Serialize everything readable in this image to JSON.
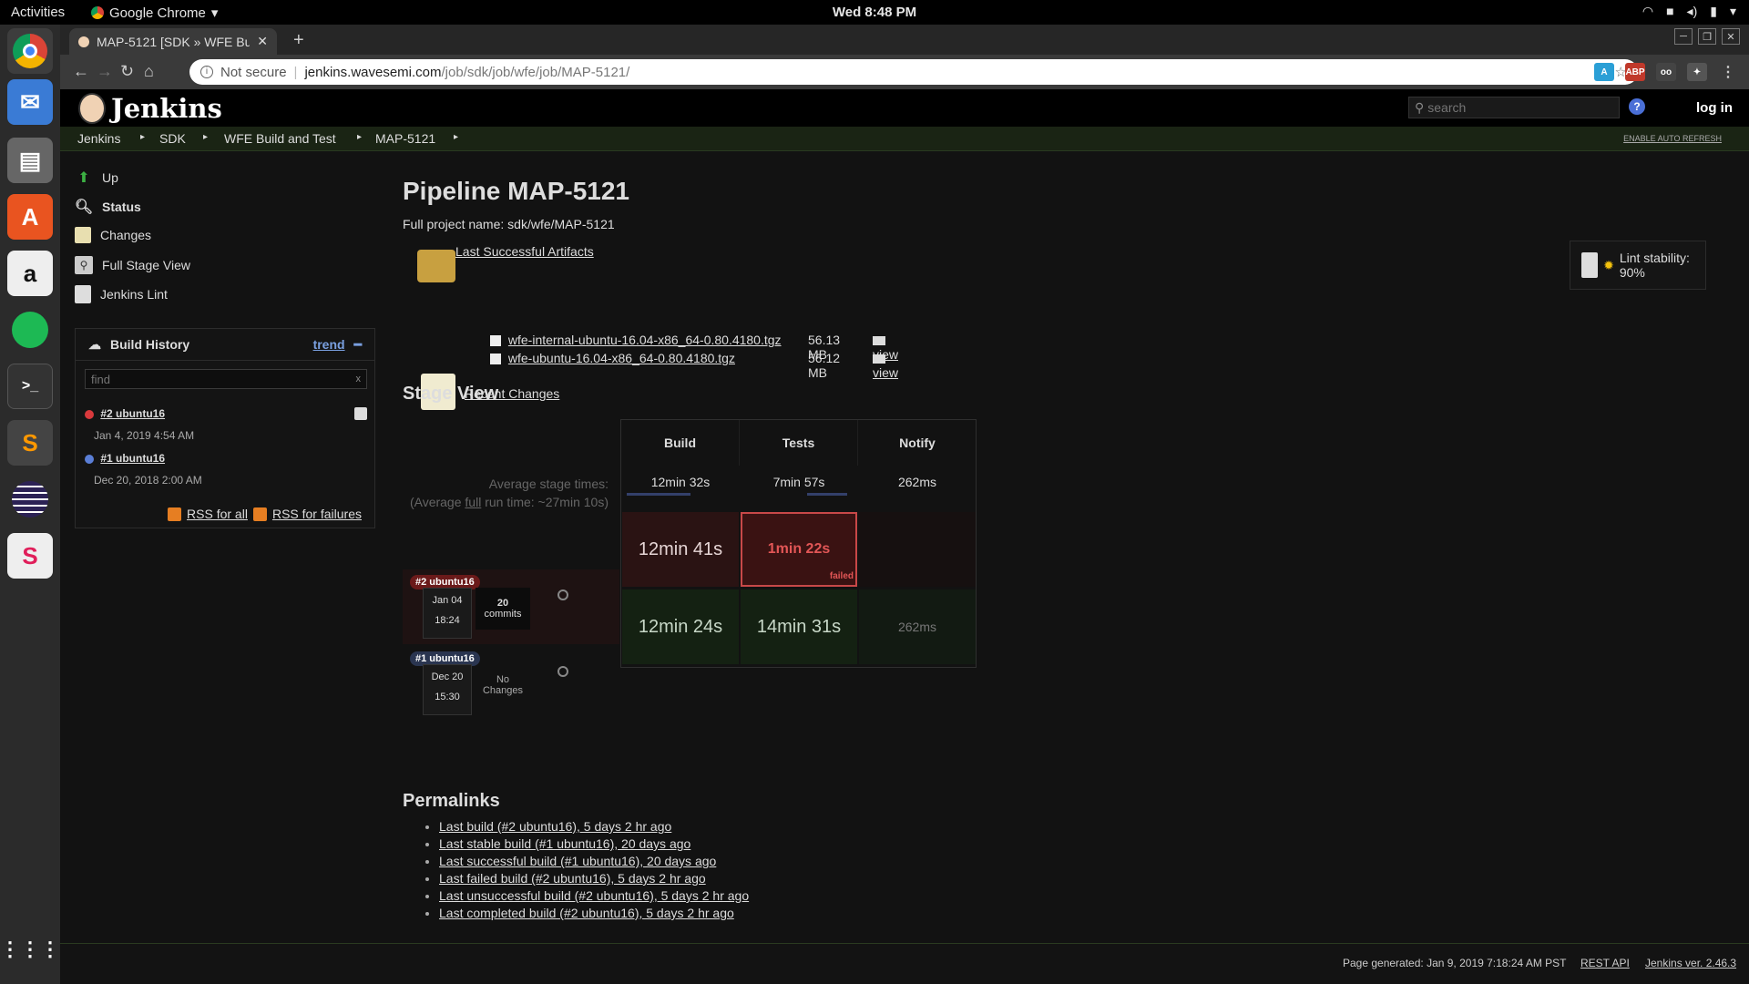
{
  "topbar": {
    "activities": "Activities",
    "app_name": "Google Chrome",
    "clock": "Wed  8:48 PM"
  },
  "browser": {
    "tab_title": "MAP-5121 [SDK » WFE Bu",
    "not_secure": "Not secure",
    "url_host": "jenkins.wavesemi.com",
    "url_path": "/job/sdk/job/wfe/job/MAP-5121/"
  },
  "jenkins": {
    "logo": "Jenkins",
    "search_placeholder": "search",
    "help": "?",
    "login": "log in"
  },
  "breadcrumbs": [
    "Jenkins",
    "SDK",
    "WFE Build and Test",
    "MAP-5121"
  ],
  "auto_refresh": "ENABLE AUTO REFRESH",
  "sidebar": {
    "tasks": [
      "Up",
      "Status",
      "Changes",
      "Full Stage View",
      "Jenkins Lint"
    ]
  },
  "build_history": {
    "title": "Build History",
    "trend": "trend",
    "find_placeholder": "find",
    "clear": "x",
    "builds": [
      {
        "label": "#2 ubuntu16",
        "date": "Jan 4, 2019 4:54 AM",
        "status_color": "#d9393c"
      },
      {
        "label": "#1 ubuntu16",
        "date": "Dec 20, 2018 2:00 AM",
        "status_color": "#5a7ed6"
      }
    ],
    "rss_all": "RSS for all",
    "rss_failures": "RSS for failures"
  },
  "main": {
    "title": "Pipeline MAP-5121",
    "full_name": "Full project name: sdk/wfe/MAP-5121",
    "last_artifacts": "Last Successful Artifacts",
    "artifacts": [
      {
        "file": "wfe-internal-ubuntu-16.04-x86_64-0.80.4180.tgz",
        "size": "56.13 MB",
        "view": "view"
      },
      {
        "file": "wfe-ubuntu-16.04-x86_64-0.80.4180.tgz",
        "size": "56.12 MB",
        "view": "view"
      }
    ],
    "recent_changes": "Recent Changes",
    "lint_stability": "Lint stability: 90%"
  },
  "stage_view": {
    "title": "Stage View",
    "avg_label": "Average stage times:",
    "avg_full_prefix": "(Average",
    "avg_full_word": "full",
    "avg_full_suffix": "run time: ~27min 10s)",
    "stages": [
      "Build",
      "Tests",
      "Notify"
    ],
    "averages": [
      "12min 32s",
      "7min 57s",
      "262ms"
    ],
    "runs": [
      {
        "badge": "#2 ubuntu16",
        "date": "Jan 04",
        "time": "18:24",
        "commits_count": "20",
        "commits_label": "commits",
        "cells": [
          "12min 41s",
          "1min 22s",
          ""
        ],
        "failed_label": "failed"
      },
      {
        "badge": "#1 ubuntu16",
        "date": "Dec 20",
        "time": "15:30",
        "commits_count": "No",
        "commits_label": "Changes",
        "cells": [
          "12min 24s",
          "14min 31s",
          "262ms"
        ]
      }
    ]
  },
  "permalinks": {
    "title": "Permalinks",
    "items": [
      "Last build (#2 ubuntu16), 5 days 2 hr ago",
      "Last stable build (#1 ubuntu16), 20 days ago",
      "Last successful build (#1 ubuntu16), 20 days ago",
      "Last failed build (#2 ubuntu16), 5 days 2 hr ago",
      "Last unsuccessful build (#2 ubuntu16), 5 days 2 hr ago",
      "Last completed build (#2 ubuntu16), 5 days 2 hr ago"
    ]
  },
  "footer": {
    "generated": "Page generated: Jan 9, 2019 7:18:24 AM PST",
    "rest_api": "REST API",
    "version": "Jenkins ver. 2.46.3"
  }
}
